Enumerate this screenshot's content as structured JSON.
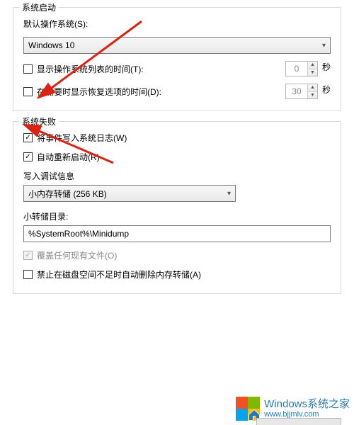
{
  "startup": {
    "title": "系统启动",
    "defaultOsLabel": "默认操作系统(S):",
    "defaultOsValue": "Windows 10",
    "showOsListLabel": "显示操作系统列表的时间(T):",
    "showOsListChecked": false,
    "showOsListValue": "0",
    "showRecoveryLabel": "在需要时显示恢复选项的时间(D):",
    "showRecoveryChecked": false,
    "showRecoveryValue": "30",
    "secondsLabel": "秒"
  },
  "failure": {
    "title": "系统失败",
    "writeLogLabel": "将事件写入系统日志(W)",
    "writeLogChecked": true,
    "autoRestartLabel": "自动重新启动(R)",
    "autoRestartChecked": true,
    "debugInfoLabel": "写入调试信息",
    "dumpTypeValue": "小内存转储 (256 KB)",
    "dumpDirLabel": "小转储目录:",
    "dumpDirValue": "%SystemRoot%\\Minidump",
    "overwriteLabel": "覆盖任何现有文件(O)",
    "overwriteChecked": true,
    "disableAutoDeleteLabel": "禁止在磁盘空间不足时自动删除内存转储(A)",
    "disableAutoDeleteChecked": false
  },
  "watermark": {
    "line1": "Windows系统之家",
    "line2": "www.bjjmlv.com"
  }
}
